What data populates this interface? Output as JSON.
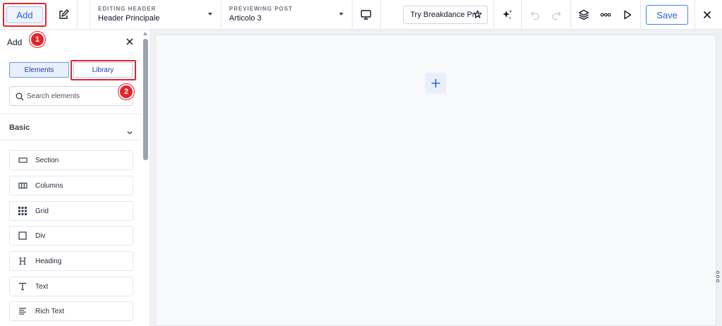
{
  "topbar": {
    "add_label": "Add",
    "editing_label": "EDITING HEADER",
    "editing_value": "Header Principale",
    "previewing_label": "PREVIEWING POST",
    "previewing_value": "Articolo 3",
    "try_pro_label": "Try Breakdance Pro",
    "save_label": "Save"
  },
  "annotations": {
    "badge_1": "1",
    "badge_2": "2"
  },
  "sidebar": {
    "title": "Add",
    "tabs": [
      {
        "label": "Elements",
        "active": true
      },
      {
        "label": "Library",
        "active": false
      }
    ],
    "search": {
      "placeholder": "Search elements",
      "value": ""
    },
    "category": "Basic",
    "items": [
      {
        "label": "Section",
        "icon": "section-icon"
      },
      {
        "label": "Columns",
        "icon": "columns-icon"
      },
      {
        "label": "Grid",
        "icon": "grid-icon"
      },
      {
        "label": "Div",
        "icon": "div-icon"
      },
      {
        "label": "Heading",
        "icon": "heading-icon"
      },
      {
        "label": "Text",
        "icon": "text-icon"
      },
      {
        "label": "Rich Text",
        "icon": "rich-text-icon"
      }
    ]
  },
  "colors": {
    "accent": "#2563eb",
    "highlight": "#e3242b",
    "canvas": "#f8f9fb"
  }
}
